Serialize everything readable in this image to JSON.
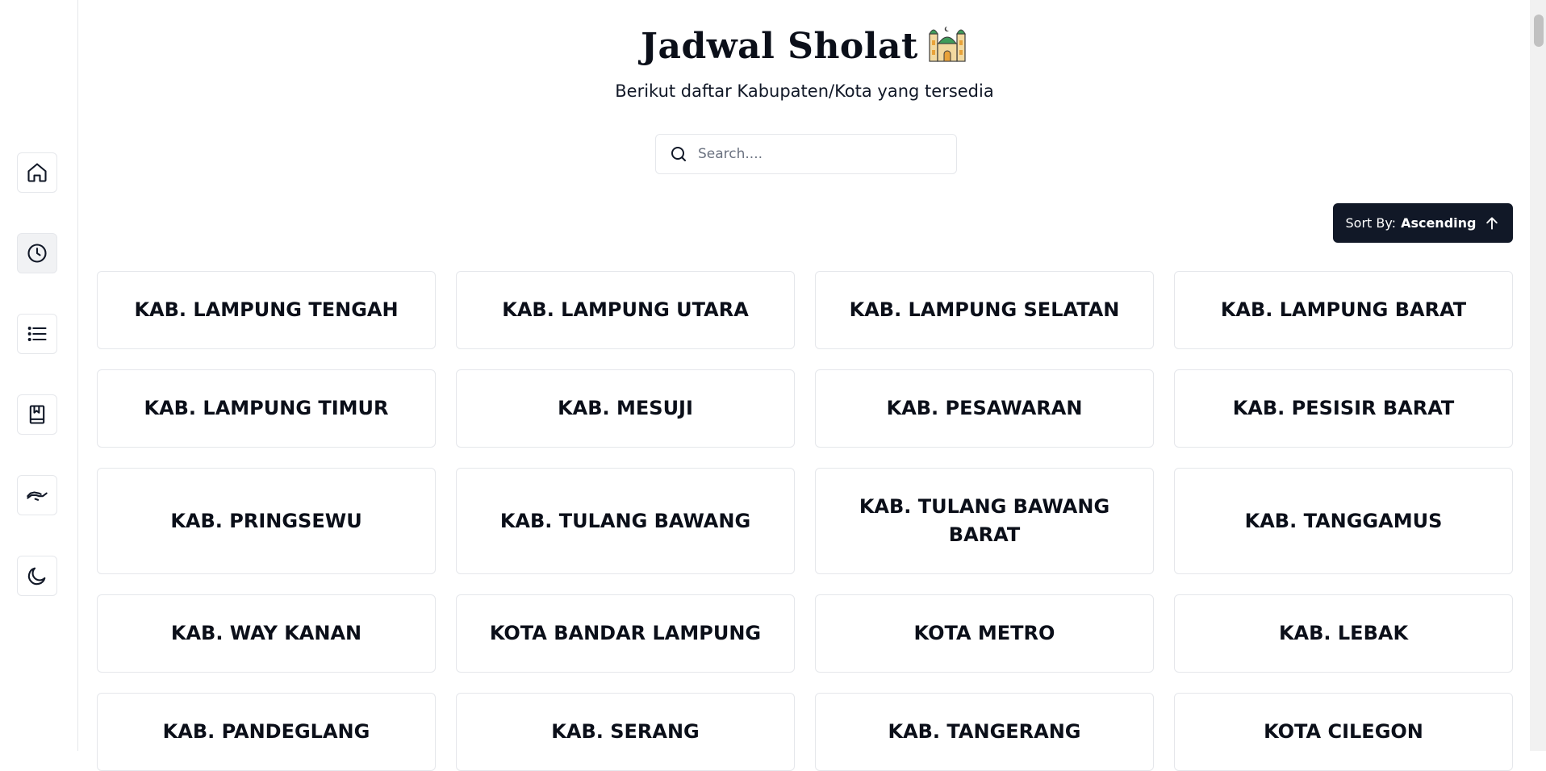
{
  "header": {
    "title": "Jadwal Sholat",
    "subtitle": "Berikut daftar Kabupaten/Kota yang tersedia"
  },
  "search": {
    "placeholder": "Search...."
  },
  "sort": {
    "label": "Sort By:",
    "value": "Ascending"
  },
  "sidebar": {
    "items": [
      {
        "name": "home",
        "icon": "home-icon",
        "active": false
      },
      {
        "name": "clock",
        "icon": "clock-icon",
        "active": true
      },
      {
        "name": "list",
        "icon": "list-icon",
        "active": false
      },
      {
        "name": "book",
        "icon": "book-icon",
        "active": false
      },
      {
        "name": "donate",
        "icon": "hand-icon",
        "active": false
      },
      {
        "name": "theme",
        "icon": "moon-icon",
        "active": false
      }
    ]
  },
  "cities": [
    "KAB. LAMPUNG TENGAH",
    "KAB. LAMPUNG UTARA",
    "KAB. LAMPUNG SELATAN",
    "KAB. LAMPUNG BARAT",
    "KAB. LAMPUNG TIMUR",
    "KAB. MESUJI",
    "KAB. PESAWARAN",
    "KAB. PESISIR BARAT",
    "KAB. PRINGSEWU",
    "KAB. TULANG BAWANG",
    "KAB. TULANG BAWANG BARAT",
    "KAB. TANGGAMUS",
    "KAB. WAY KANAN",
    "KOTA BANDAR LAMPUNG",
    "KOTA METRO",
    "KAB. LEBAK",
    "KAB. PANDEGLANG",
    "KAB. SERANG",
    "KAB. TANGERANG",
    "KOTA CILEGON"
  ],
  "colors": {
    "primary_button": "#111827",
    "border": "#e5e7eb",
    "text": "#0b0f19"
  }
}
